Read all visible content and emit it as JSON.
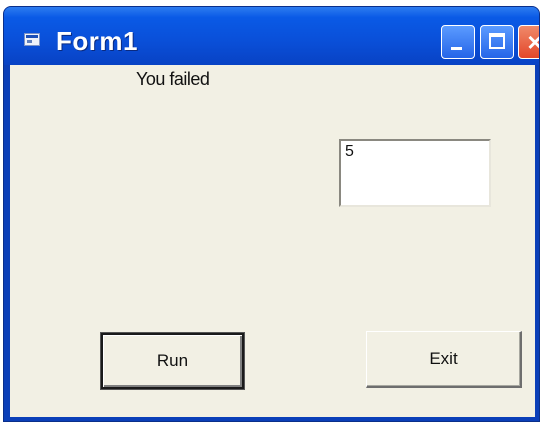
{
  "window": {
    "title": "Form1",
    "close_glyph": "×"
  },
  "form": {
    "status_label": "You failed",
    "textbox_value": "5",
    "run_button_label": "Run",
    "exit_button_label": "Exit"
  },
  "icons": {
    "app": "form-app-icon",
    "minimize": "minimize-icon",
    "maximize": "maximize-icon",
    "close": "close-icon"
  },
  "colors": {
    "titlebar": "#0a4fd8",
    "client_background": "#f2f0e4",
    "close_button": "#e3462a"
  }
}
